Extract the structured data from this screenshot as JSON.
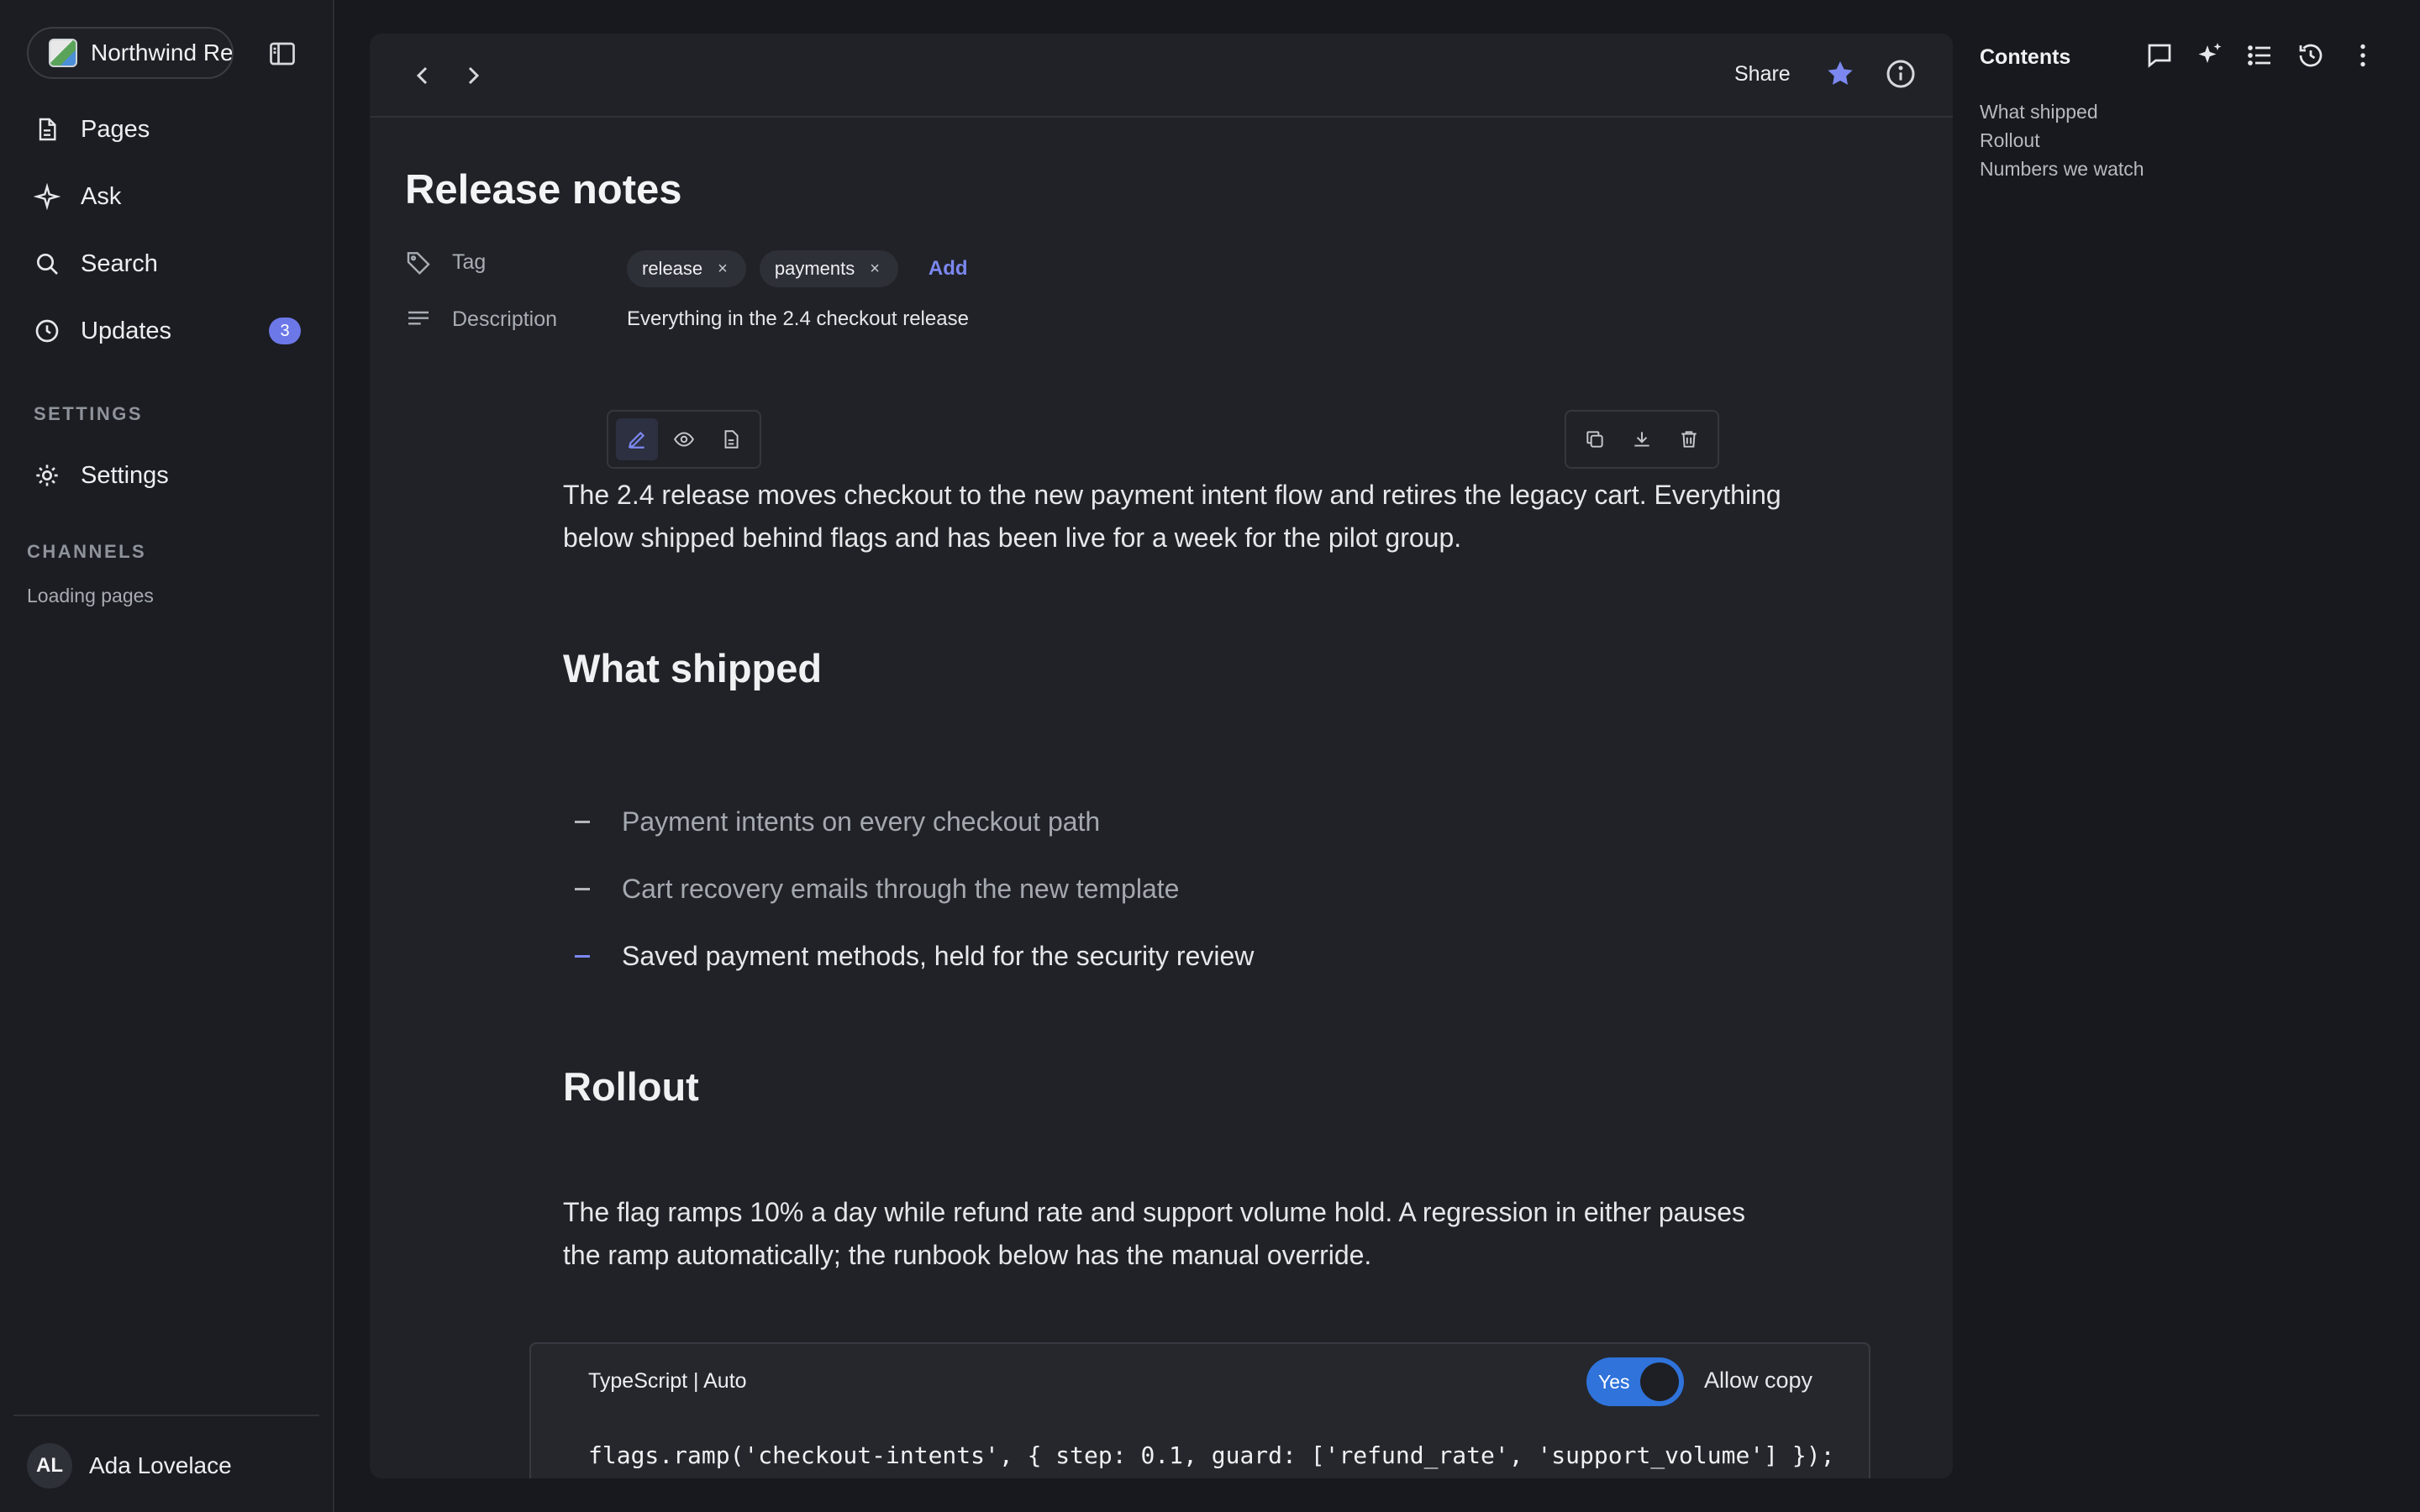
{
  "sidebar": {
    "workspace_name": "Northwind Re",
    "nav": [
      {
        "label": "Pages",
        "icon": "page-icon"
      },
      {
        "label": "Ask",
        "icon": "sparkle-icon"
      },
      {
        "label": "Search",
        "icon": "search-icon"
      },
      {
        "label": "Updates",
        "icon": "clock-icon",
        "badge": "3"
      }
    ],
    "settings_section": "SETTINGS",
    "settings_item": "Settings",
    "channels_section": "CHANNELS",
    "channels_status": "Loading pages",
    "user": {
      "initials": "AL",
      "name": "Ada Lovelace"
    }
  },
  "topbar": {
    "share_label": "Share"
  },
  "page": {
    "title": "Release notes",
    "properties": {
      "tag_label": "Tag",
      "tags": [
        "release",
        "payments"
      ],
      "tag_remove_glyph": "×",
      "add_label": "Add",
      "description_label": "Description",
      "description_value": "Everything in the 2.4 checkout release"
    },
    "intro": "The 2.4 release moves checkout to the new payment intent flow and retires the legacy cart. Everything below shipped behind flags and has been live for a week for the pilot group.",
    "heading_shipped": "What shipped",
    "shipped_items": [
      "Payment intents on every checkout path",
      "Cart recovery emails through the new template",
      "Saved payment methods, held for the security review"
    ],
    "heading_rollout": "Rollout",
    "rollout_text": "The flag ramps 10% a day while refund rate and support volume hold. A regression in either pauses the ramp automatically; the runbook below has the manual override.",
    "code_block": {
      "language": "TypeScript | Auto",
      "toggle_label": "Yes",
      "toggle_on": true,
      "allow_copy_label": "Allow copy",
      "code": "flags.ramp('checkout-intents', { step: 0.1, guard: ['refund_rate', 'support_volume'] });"
    }
  },
  "right_panel": {
    "title": "Contents",
    "toc": [
      "What shipped",
      "Rollout",
      "Numbers we watch"
    ]
  },
  "colors": {
    "accent": "#7c88f0",
    "toggle_blue": "#2f73db",
    "background": "#17191e",
    "panel": "#202227"
  }
}
